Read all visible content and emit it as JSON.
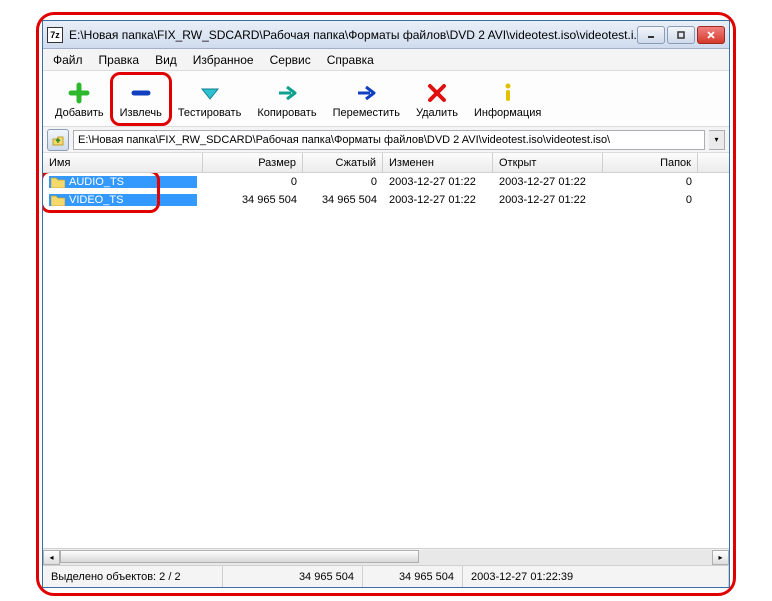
{
  "window": {
    "title": "E:\\Новая папка\\FIX_RW_SDCARD\\Рабочая папка\\Форматы файлов\\DVD 2 AVI\\videotest.iso\\videotest.i...",
    "app_icon_label": "7z"
  },
  "menu": {
    "file": "Файл",
    "edit": "Правка",
    "view": "Вид",
    "favorites": "Избранное",
    "tools": "Сервис",
    "help": "Справка"
  },
  "toolbar": {
    "add": "Добавить",
    "extract": "Извлечь",
    "test": "Тестировать",
    "copy": "Копировать",
    "move": "Переместить",
    "delete": "Удалить",
    "info": "Информация"
  },
  "path": {
    "value": "E:\\Новая папка\\FIX_RW_SDCARD\\Рабочая папка\\Форматы файлов\\DVD 2 AVI\\videotest.iso\\videotest.iso\\"
  },
  "columns": {
    "name": "Имя",
    "size": "Размер",
    "packed": "Сжатый",
    "modified": "Изменен",
    "opened": "Открыт",
    "folders": "Папок"
  },
  "rows": [
    {
      "name": "AUDIO_TS",
      "size": "0",
      "packed": "0",
      "modified": "2003-12-27 01:22",
      "opened": "2003-12-27 01:22",
      "folders": "0"
    },
    {
      "name": "VIDEO_TS",
      "size": "34 965 504",
      "packed": "34 965 504",
      "modified": "2003-12-27 01:22",
      "opened": "2003-12-27 01:22",
      "folders": "0"
    }
  ],
  "status": {
    "selected": "Выделено объектов: 2 / 2",
    "size": "34 965 504",
    "packed": "34 965 504",
    "datetime": "2003-12-27 01:22:39"
  }
}
